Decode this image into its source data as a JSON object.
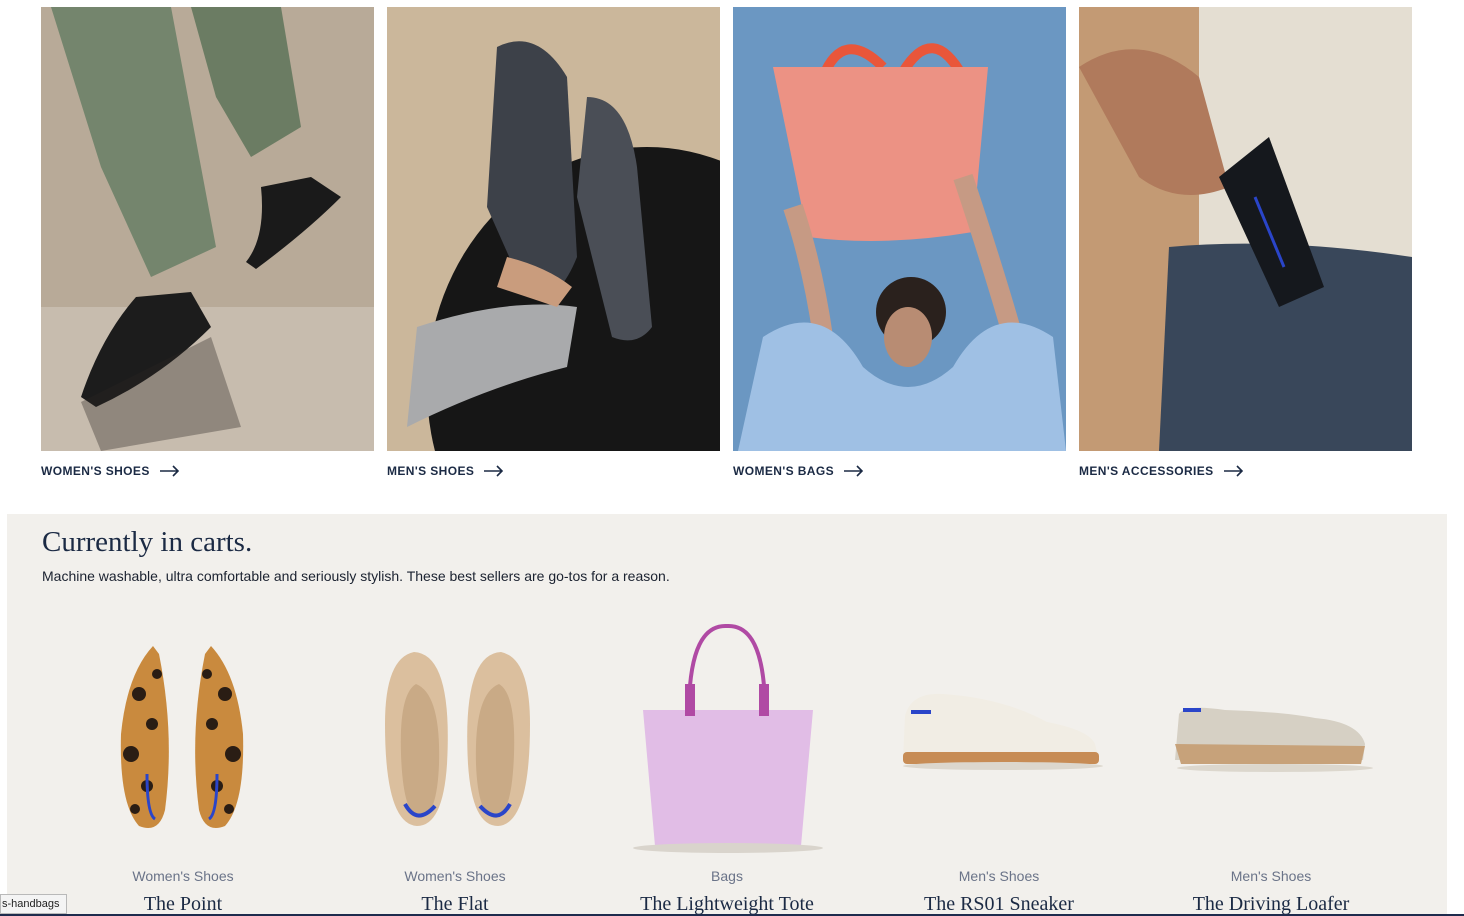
{
  "categories": [
    {
      "label": "WOMEN'S SHOES",
      "icon": "arrow-right-icon"
    },
    {
      "label": "MEN'S SHOES",
      "icon": "arrow-right-icon"
    },
    {
      "label": "WOMEN'S BAGS",
      "icon": "arrow-right-icon"
    },
    {
      "label": "MEN'S ACCESSORIES",
      "icon": "arrow-right-icon"
    }
  ],
  "carts": {
    "title": "Currently in carts.",
    "subtitle": "Machine washable, ultra comfortable and seriously stylish. These best sellers are go-tos for a reason.",
    "products": [
      {
        "category": "Women's Shoes",
        "name": "The Point"
      },
      {
        "category": "Women's Shoes",
        "name": "The Flat"
      },
      {
        "category": "Bags",
        "name": "The Lightweight Tote"
      },
      {
        "category": "Men's Shoes",
        "name": "The RS01 Sneaker"
      },
      {
        "category": "Men's Shoes",
        "name": "The Driving Loafer"
      }
    ]
  },
  "status_bar": {
    "link_text": "s-handbags"
  },
  "colors": {
    "section_bg": "#f2f0ec",
    "text_navy": "#1b2a44",
    "accent_blue": "#2a45c9"
  }
}
